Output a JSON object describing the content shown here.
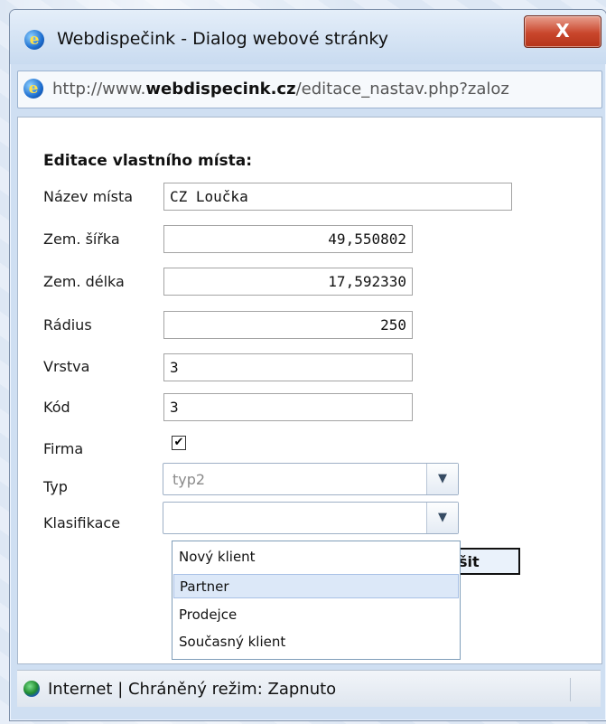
{
  "window": {
    "title": "Webdispečink - Dialog webové stránky",
    "close_label": "X",
    "title_icon": "ie-icon"
  },
  "address_bar": {
    "prefix": "http://www.",
    "domain": "webdispecink.cz",
    "path": "/editace_nastav.php?zaloz"
  },
  "form": {
    "heading": "Editace vlastního místa:",
    "fields": {
      "nazev": {
        "label": "Název místa",
        "value": "CZ Loučka"
      },
      "sirka": {
        "label": "Zem. šířka",
        "value": "49,550802"
      },
      "delka": {
        "label": "Zem. délka",
        "value": "17,592330"
      },
      "radius": {
        "label": "Rádius",
        "value": "250"
      },
      "vrstva": {
        "label": "Vrstva",
        "value": "3"
      },
      "kod": {
        "label": "Kód",
        "value": "3"
      },
      "firma": {
        "label": "Firma",
        "checked": true
      },
      "typ": {
        "label": "Typ",
        "value": "typ2"
      },
      "klasifikace": {
        "label": "Klasifikace",
        "value": ""
      }
    },
    "save_label": "šit",
    "dropdown_options": [
      "Nový klient",
      "Partner",
      "Prodejce",
      "Současný klient"
    ],
    "dropdown_highlighted": "Partner"
  },
  "status_bar": {
    "text": "Internet | Chráněný režim: Zapnuto",
    "icon": "globe-icon"
  }
}
